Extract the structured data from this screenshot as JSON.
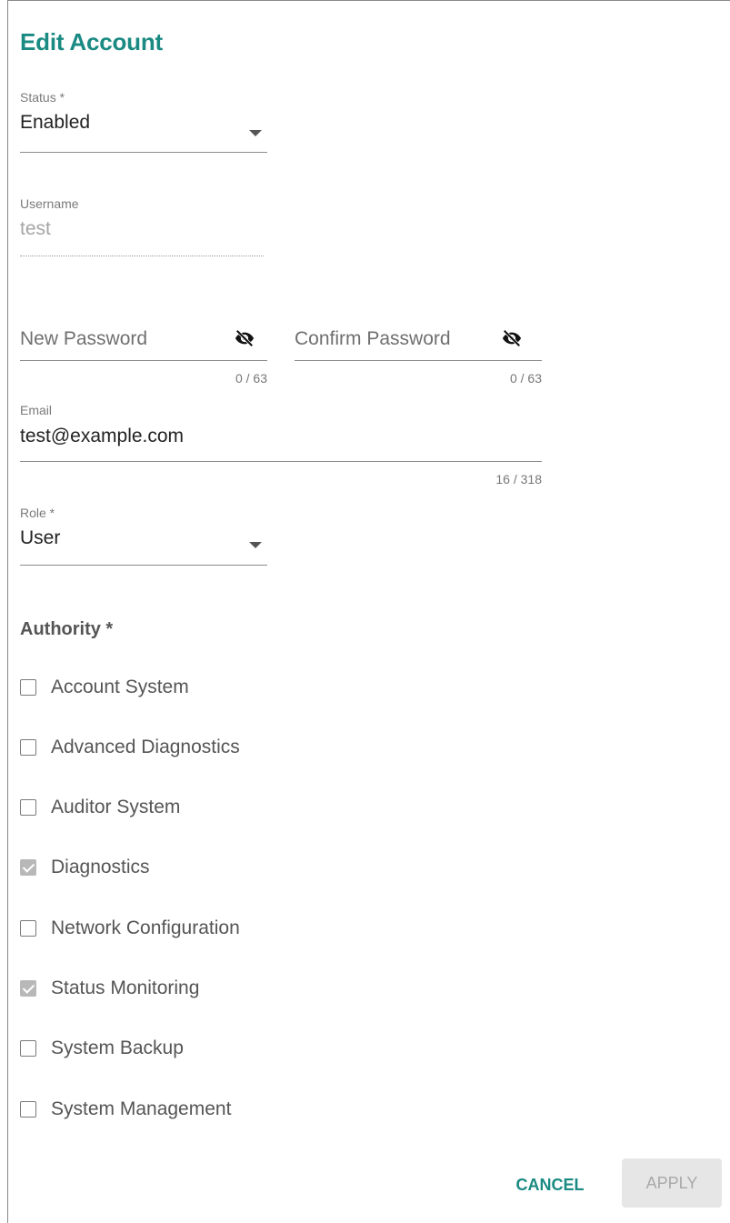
{
  "dialog": {
    "title": "Edit Account"
  },
  "status": {
    "label": "Status *",
    "value": "Enabled"
  },
  "username": {
    "label": "Username",
    "value": "test"
  },
  "new_password": {
    "placeholder": "New Password",
    "counter": "0 / 63",
    "icon": "eye-off-icon"
  },
  "confirm_password": {
    "placeholder": "Confirm Password",
    "counter": "0 / 63",
    "icon": "eye-off-icon"
  },
  "email": {
    "label": "Email",
    "value": "test@example.com",
    "counter": "16 / 318"
  },
  "role": {
    "label": "Role *",
    "value": "User"
  },
  "authority": {
    "title": "Authority *",
    "items": [
      {
        "label": "Account System",
        "checked": false
      },
      {
        "label": "Advanced Diagnostics",
        "checked": false
      },
      {
        "label": "Auditor System",
        "checked": false
      },
      {
        "label": "Diagnostics",
        "checked": true
      },
      {
        "label": "Network Configuration",
        "checked": false
      },
      {
        "label": "Status Monitoring",
        "checked": true
      },
      {
        "label": "System Backup",
        "checked": false
      },
      {
        "label": "System Management",
        "checked": false
      }
    ]
  },
  "actions": {
    "cancel": "CANCEL",
    "apply": "APPLY"
  },
  "colors": {
    "accent": "#1a8a82",
    "disabled_bg": "#e6e6e6",
    "disabled_text": "#a9a9a9"
  }
}
